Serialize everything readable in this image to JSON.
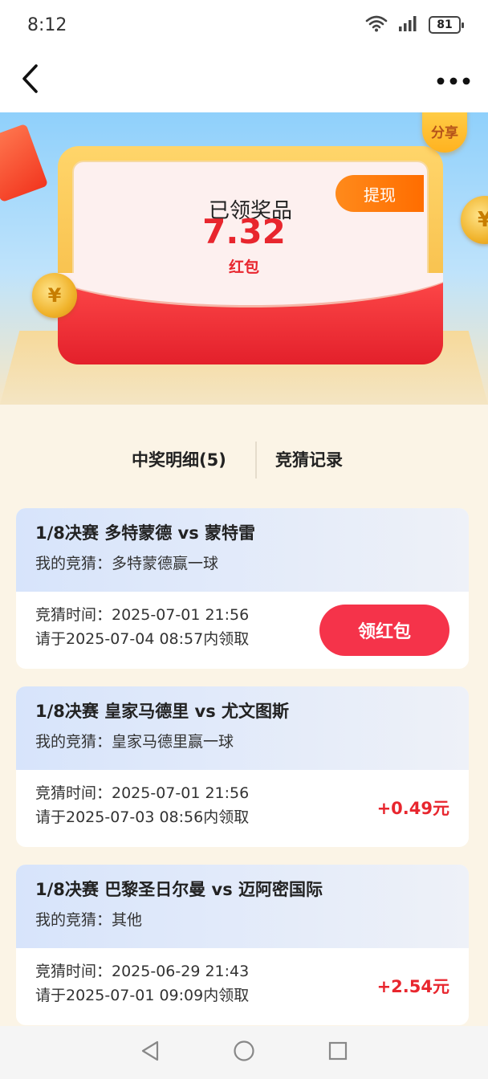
{
  "status_bar": {
    "time": "8:12",
    "battery": "81",
    "icons": [
      "wifi-icon",
      "signal-icon",
      "battery-icon"
    ]
  },
  "nav": {
    "back_icon": "chevron-left-icon",
    "more_icon": "more-dots-icon"
  },
  "hero": {
    "share_label": "分享",
    "prize_title": "已领奖品",
    "prize_amount": "7.32",
    "prize_unit": "红包",
    "withdraw_label": "提现"
  },
  "tabs": {
    "detail": "中奖明细(5)",
    "record": "竞猜记录"
  },
  "records": [
    {
      "match": "1/8决赛 多特蒙德 vs 蒙特雷",
      "guess": "我的竞猜：多特蒙德赢一球",
      "guess_time": "竞猜时间：2025-07-01 21:56",
      "deadline": "请于2025-07-04 08:57内领取",
      "action_label": "领红包"
    },
    {
      "match": "1/8决赛 皇家马德里 vs 尤文图斯",
      "guess": "我的竞猜：皇家马德里赢一球",
      "guess_time": "竞猜时间：2025-07-01 21:56",
      "deadline": "请于2025-07-03 08:56内领取",
      "reward": "+0.49元"
    },
    {
      "match": "1/8决赛 巴黎圣日尔曼 vs 迈阿密国际",
      "guess": "我的竞猜：其他",
      "guess_time": "竞猜时间：2025-06-29 21:43",
      "deadline": "请于2025-07-01 09:09内领取",
      "reward": "+2.54元"
    }
  ],
  "colors": {
    "accent_red": "#e8262e",
    "claim_button": "#f5334a",
    "withdraw_orange": "#ff7a0a",
    "hero_blue": "#8fd0fb"
  }
}
